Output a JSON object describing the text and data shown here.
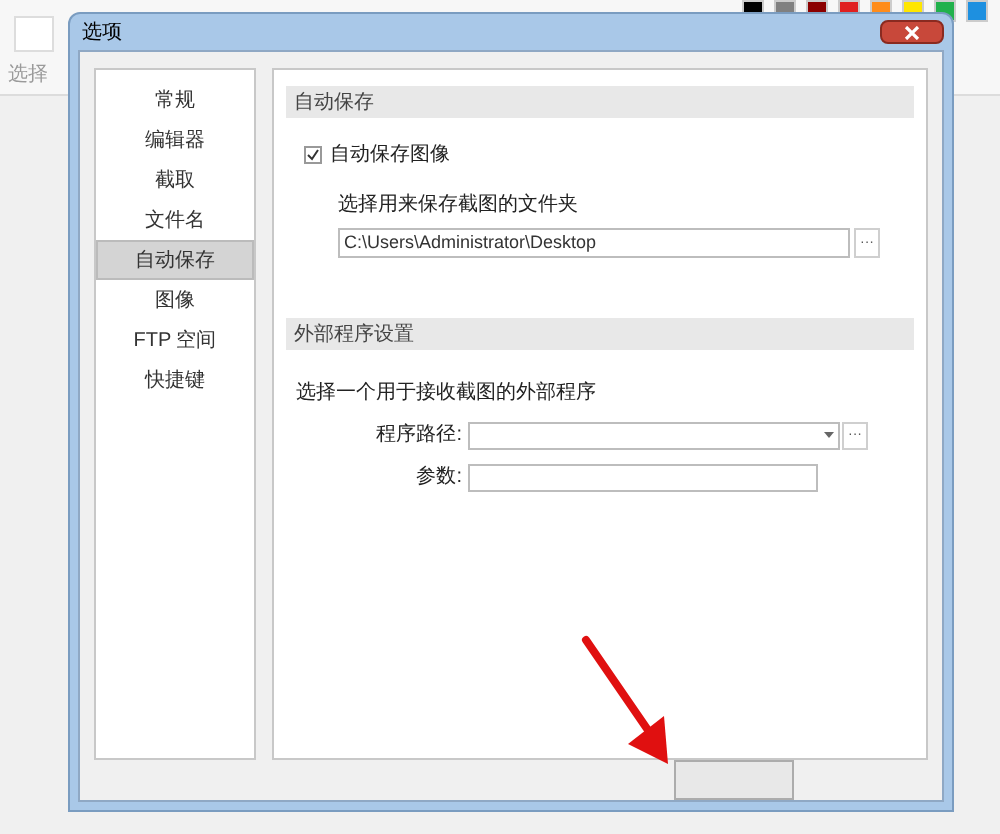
{
  "background_app": {
    "tool_label": "选择",
    "swatches": [
      {
        "color": "#000000"
      },
      {
        "color": "#808080"
      },
      {
        "color": "#8b0000"
      },
      {
        "color": "#e02020"
      },
      {
        "color": "#ff8c1a"
      },
      {
        "color": "#ffe600"
      },
      {
        "color": "#22b14c"
      },
      {
        "color": "#1e90e0"
      }
    ]
  },
  "window": {
    "title": "选项"
  },
  "sidebar": {
    "items": [
      {
        "label": "常规",
        "selected": false
      },
      {
        "label": "编辑器",
        "selected": false
      },
      {
        "label": "截取",
        "selected": false
      },
      {
        "label": "文件名",
        "selected": false
      },
      {
        "label": "自动保存",
        "selected": true
      },
      {
        "label": "图像",
        "selected": false
      },
      {
        "label": "FTP 空间",
        "selected": false
      },
      {
        "label": "快捷键",
        "selected": false
      }
    ]
  },
  "auto_save": {
    "header": "自动保存",
    "checkbox": {
      "label": "自动保存图像",
      "checked": true
    },
    "folder_label": "选择用来保存截图的文件夹",
    "folder_value": "C:\\Users\\Administrator\\Desktop",
    "browse": "···"
  },
  "external": {
    "header": "外部程序设置",
    "description": "选择一个用于接收截图的外部程序",
    "path_label": "程序路径:",
    "path_browse": "···",
    "args_label": "参数:"
  }
}
